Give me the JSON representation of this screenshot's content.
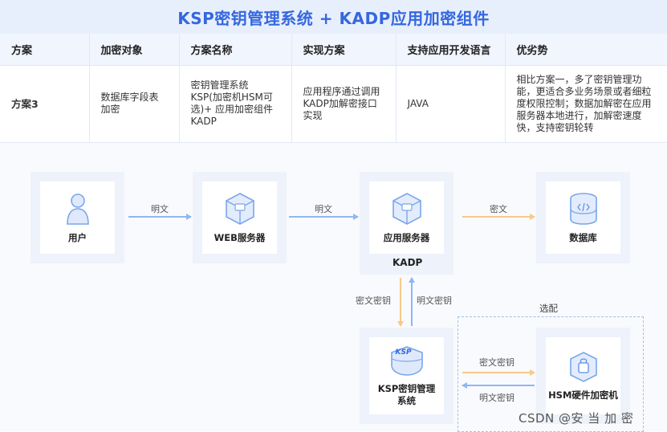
{
  "title": "KSP密钥管理系统 + KADP应用加密组件",
  "table": {
    "headers": [
      "方案",
      "加密对象",
      "方案名称",
      "实现方案",
      "支持应用开发语言",
      "优劣势"
    ],
    "rows": [
      {
        "plan": "方案3",
        "target": "数据库字段表加密",
        "name": "密钥管理系统KSP(加密机HSM可选)+ 应用加密组件KADP",
        "impl": "应用程序通过调用KADP加解密接口实现",
        "lang": "JAVA",
        "pros": "相比方案一，多了密钥管理功能，更适合多业务场景或者细粒度权限控制；数据加解密在应用服务器本地进行，加解密速度快，支持密钥轮转"
      }
    ]
  },
  "diagram": {
    "nodes": {
      "user": "用户",
      "web": "WEB服务器",
      "app": "应用服务器",
      "kadp": "KADP",
      "db": "数据库",
      "ksp_line1": "KSP密钥管理",
      "ksp_line2": "系统",
      "ksp_badge": "KSP",
      "hsm": "HSM硬件加密机"
    },
    "edges": {
      "user_web": "明文",
      "web_app": "明文",
      "app_db": "密文",
      "down": "密文密钥",
      "up": "明文密钥",
      "to_hsm": "密文密钥",
      "from_hsm": "明文密钥"
    },
    "optional": "选配",
    "colors": {
      "blue_arrow": "#8fb7f0",
      "orange_arrow": "#f7c98a",
      "accent": "#3567df"
    }
  },
  "watermark": "CSDN @安 当 加 密"
}
